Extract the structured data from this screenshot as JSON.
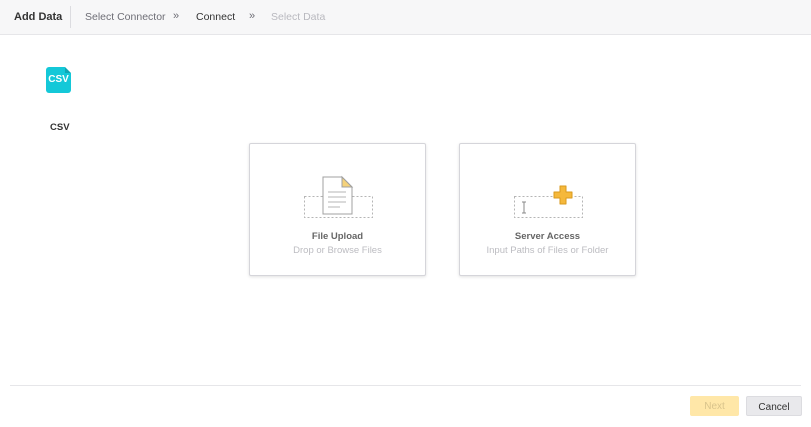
{
  "header": {
    "title": "Add Data",
    "breadcrumb": [
      {
        "label": "Select Connector",
        "state": "done"
      },
      {
        "label": "Connect",
        "state": "current"
      },
      {
        "label": "Select Data",
        "state": "pending"
      }
    ],
    "separator": "»"
  },
  "connector": {
    "icon": "csv-file-icon",
    "icon_text": "CSV",
    "label": "CSV",
    "color": "#14c8d8"
  },
  "options": [
    {
      "title": "File Upload",
      "subtitle": "Drop or Browse Files",
      "icon": "document-icon"
    },
    {
      "title": "Server Access",
      "subtitle": "Input Paths of Files or Folder",
      "icon": "plus-icon"
    }
  ],
  "footer": {
    "next_label": "Next",
    "cancel_label": "Cancel",
    "next_enabled": false
  },
  "colors": {
    "accent": "#14c8d8",
    "next_button": "#ffe7a8",
    "plus": "#f5b83b"
  }
}
